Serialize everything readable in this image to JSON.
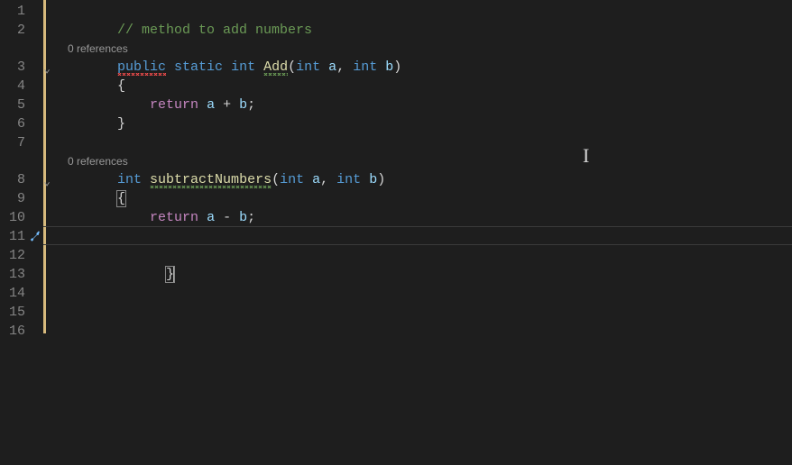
{
  "gutter": {
    "l1": "1",
    "l2": "2",
    "l3": "3",
    "l4": "4",
    "l5": "5",
    "l6": "6",
    "l7": "7",
    "l8": "8",
    "l9": "9",
    "l10": "10",
    "l11": "11",
    "l12": "12",
    "l13": "13",
    "l14": "14",
    "l15": "15",
    "l16": "16"
  },
  "codelens": {
    "ref1": "0 references",
    "ref2": "0 references"
  },
  "code": {
    "comment1": "// method to add numbers",
    "public": "public",
    "static": "static",
    "int": "int",
    "Add": "Add",
    "subtractNumbers": "subtractNumbers",
    "a": "a",
    "b": "b",
    "lp": "(",
    "rp": ")",
    "comma": ",",
    "lb": "{",
    "rb": "}",
    "semi": ";",
    "return": "return",
    "plus": "+",
    "minus": "-",
    "sp": " ",
    "ind2": "        ",
    "ind3": "            "
  },
  "colors": {
    "background": "#1e1e1e",
    "keyword": "#569cd6",
    "method": "#dcdcaa",
    "variable": "#9cdcfe",
    "comment": "#6a9955",
    "control": "#c586c0",
    "changeBar": "#d7ba7d"
  }
}
